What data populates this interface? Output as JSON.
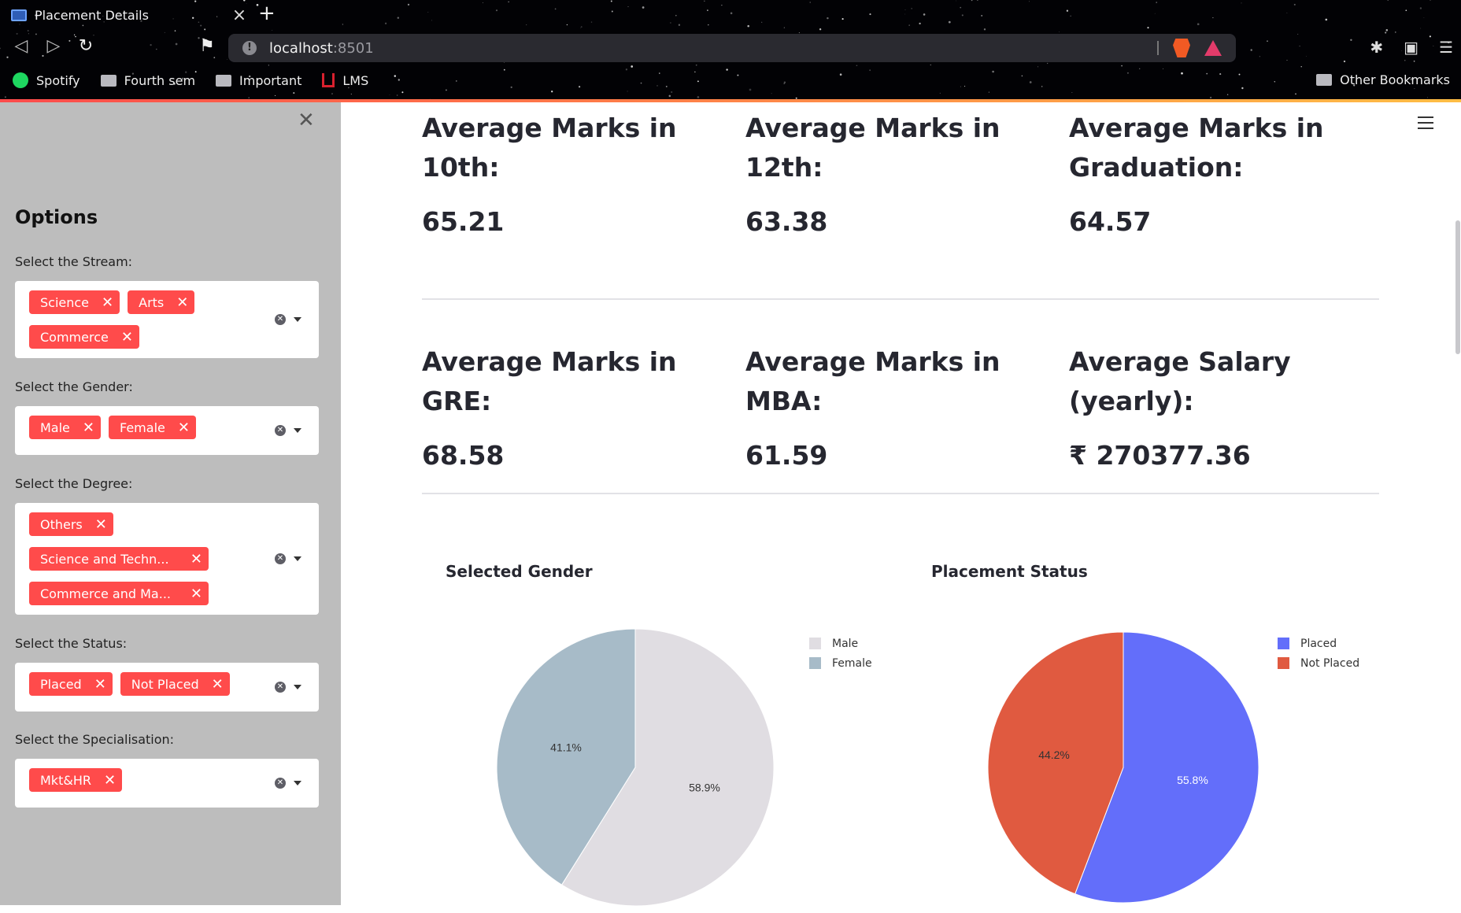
{
  "browser": {
    "tab_title": "Placement Details",
    "url_host": "localhost",
    "url_port": ":8501",
    "bookmarks": [
      "Spotify",
      "Fourth sem",
      "Important",
      "LMS"
    ],
    "other_bookmarks": "Other Bookmarks"
  },
  "sidebar": {
    "heading": "Options",
    "filters": [
      {
        "label": "Select the Stream:",
        "tags": [
          "Science",
          "Arts",
          "Commerce"
        ]
      },
      {
        "label": "Select the Gender:",
        "tags": [
          "Male",
          "Female"
        ]
      },
      {
        "label": "Select the Degree:",
        "tags": [
          "Others",
          "Science and Techn...",
          "Commerce and Ma..."
        ]
      },
      {
        "label": "Select the Status:",
        "tags": [
          "Placed",
          "Not Placed"
        ]
      },
      {
        "label": "Select the Specialisation:",
        "tags": [
          "Mkt&HR"
        ]
      }
    ]
  },
  "metrics": [
    {
      "label": "Average Marks in 10th:",
      "value": "65.21"
    },
    {
      "label": "Average Marks in 12th:",
      "value": "63.38"
    },
    {
      "label": "Average Marks in Graduation:",
      "value": "64.57"
    },
    {
      "label": "Average Marks in GRE:",
      "value": "68.58"
    },
    {
      "label": "Average Marks in MBA:",
      "value": "61.59"
    },
    {
      "label": "Average Salary (yearly):",
      "value": "₹ 270377.36"
    }
  ],
  "colors": {
    "accent": "#ff4b4b",
    "male": "#e0dde2",
    "female": "#a7bbc8",
    "placed": "#636efa",
    "not_placed": "#e05a40"
  },
  "chart_data": [
    {
      "type": "pie",
      "title": "Selected Gender",
      "labels": [
        "Male",
        "Female"
      ],
      "values": [
        58.9,
        41.1
      ],
      "data_labels": [
        "58.9%",
        "41.1%"
      ],
      "colors": [
        "#e0dde2",
        "#a7bbc8"
      ],
      "legend": "top-right"
    },
    {
      "type": "pie",
      "title": "Placement Status",
      "labels": [
        "Placed",
        "Not Placed"
      ],
      "values": [
        55.8,
        44.2
      ],
      "data_labels": [
        "55.8%",
        "44.2%"
      ],
      "colors": [
        "#636efa",
        "#e05a40"
      ],
      "legend": "top-right"
    }
  ]
}
